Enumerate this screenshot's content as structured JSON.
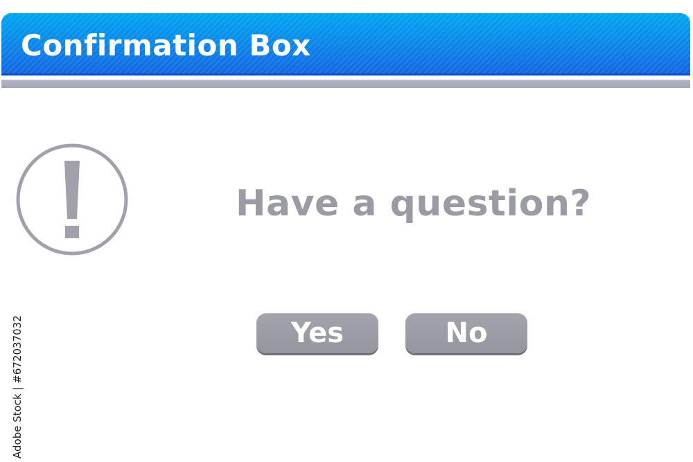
{
  "dialog": {
    "title": "Confirmation Box",
    "message": "Have a question?",
    "icon": "exclamation-circle-icon",
    "buttons": {
      "yes_label": "Yes",
      "no_label": "No"
    }
  },
  "watermark": {
    "text": "Adobe Stock | #672037032"
  },
  "colors": {
    "title_bar": "#0b86ea",
    "accent_gray": "#9b9ba5",
    "button_bg": "#9b9ca6",
    "underline": "#adaec0"
  }
}
